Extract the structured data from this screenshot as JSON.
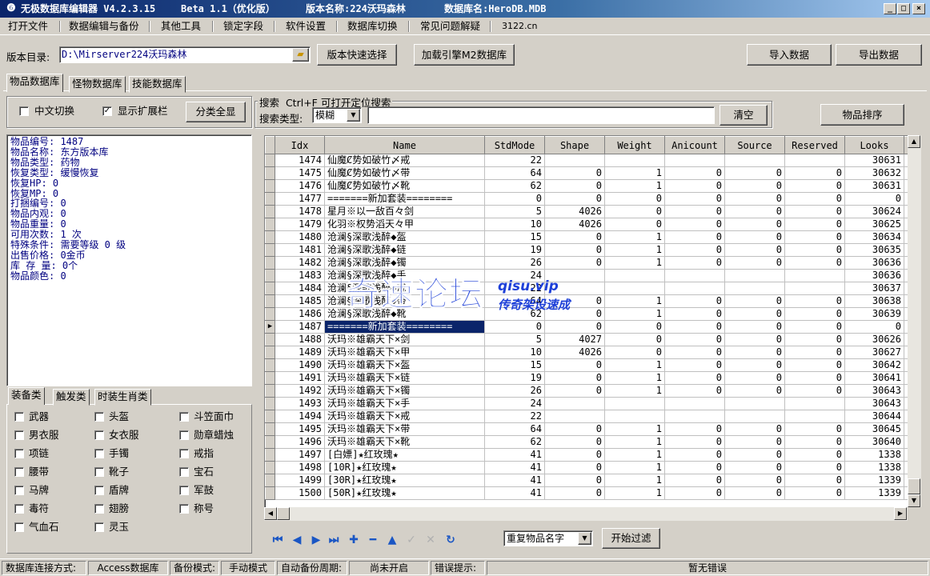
{
  "window": {
    "title_app": "无极数据库编辑器 V4.2.3.15",
    "title_beta": "Beta 1.1（优化版）",
    "title_version": "版本名称:224沃玛森林",
    "title_db": "数据库名:HeroDB.MDB",
    "btn_min": "_",
    "btn_max": "□",
    "btn_close": "×"
  },
  "menu": [
    "打开文件",
    "数据编辑与备份",
    "其他工具",
    "锁定字段",
    "软件设置",
    "数据库切换",
    "常见问题解疑",
    "3122.cn"
  ],
  "toolbar": {
    "dir_label": "版本目录:",
    "dir_value": "D:\\Mirserver224沃玛森林",
    "quick_select": "版本快速选择",
    "load_engine": "加载引擎M2数据库",
    "import": "导入数据",
    "export": "导出数据"
  },
  "tabs": [
    "物品数据库",
    "怪物数据库",
    "技能数据库"
  ],
  "left_panel": {
    "chinese_toggle": "中文切换",
    "chinese_checked": false,
    "show_ext": "显示扩展栏",
    "show_ext_checked": true,
    "show_all": "分类全显"
  },
  "search": {
    "group_title": "搜索  Ctrl+F 可打开定位搜索",
    "type_label": "搜索类型:",
    "type_value": "模糊",
    "query": "",
    "clear": "清空",
    "sort": "物品排序"
  },
  "item_info": [
    "物品编号: 1487",
    "物品名称: 东方版本库",
    "物品类型: 药物",
    "恢复类型: 缓慢恢复",
    "恢复HP: 0",
    "恢复MP: 0",
    "打捆编号: 0",
    "物品内观: 0",
    "物品重量: 0",
    "可用次数: 1 次",
    "特殊条件: 需要等级 0 级",
    "出售价格: 0金币",
    "库 存 量: 0个",
    "物品颜色: 0"
  ],
  "category_tabs": [
    "装备类",
    "触发类",
    "时装生肖类"
  ],
  "categories": [
    [
      "武器",
      "头盔",
      "斗笠面巾"
    ],
    [
      "男衣服",
      "女衣服",
      "勋章蜡烛"
    ],
    [
      "项链",
      "手镯",
      "戒指"
    ],
    [
      "腰带",
      "靴子",
      "宝石"
    ],
    [
      "马牌",
      "盾牌",
      "军鼓"
    ],
    [
      "毒符",
      "翅膀",
      "称号"
    ],
    [
      "气血石",
      "灵玉",
      ""
    ]
  ],
  "grid": {
    "columns": [
      "Idx",
      "Name",
      "StdMode",
      "Shape",
      "Weight",
      "Anicount",
      "Source",
      "Reserved",
      "Looks"
    ],
    "selected_idx": "1487",
    "rows": [
      [
        "1474",
        "仙魔Ȼ势如破竹〆戒",
        "22",
        "",
        "",
        "",
        "",
        "",
        "30631"
      ],
      [
        "1475",
        "仙魔Ȼ势如破竹〆带",
        "64",
        "0",
        "1",
        "0",
        "0",
        "0",
        "30632"
      ],
      [
        "1476",
        "仙魔Ȼ势如破竹〆靴",
        "62",
        "0",
        "1",
        "0",
        "0",
        "0",
        "30631"
      ],
      [
        "1477",
        "=======新加套装========",
        "0",
        "0",
        "0",
        "0",
        "0",
        "0",
        "0"
      ],
      [
        "1478",
        "星月※以一敌百々剑",
        "5",
        "4026",
        "0",
        "0",
        "0",
        "0",
        "30624"
      ],
      [
        "1479",
        "化羽※权势滔天々甲",
        "10",
        "4026",
        "0",
        "0",
        "0",
        "0",
        "30625"
      ],
      [
        "1480",
        "沧澜§深歌浅醉◆盔",
        "15",
        "0",
        "1",
        "0",
        "0",
        "0",
        "30634"
      ],
      [
        "1481",
        "沧澜§深歌浅醉◆链",
        "19",
        "0",
        "1",
        "0",
        "0",
        "0",
        "30635"
      ],
      [
        "1482",
        "沧澜§深歌浅醉◆镯",
        "26",
        "0",
        "1",
        "0",
        "0",
        "0",
        "30636"
      ],
      [
        "1483",
        "沧澜§深歌浅醉◆手",
        "24",
        "",
        "",
        "",
        "",
        "",
        "30636"
      ],
      [
        "1484",
        "沧澜§深歌浅醉◆戒",
        "22",
        "",
        "",
        "",
        "",
        "",
        "30637"
      ],
      [
        "1485",
        "沧澜§深歌浅醉◆带",
        "64",
        "0",
        "1",
        "0",
        "0",
        "0",
        "30638"
      ],
      [
        "1486",
        "沧澜§深歌浅醉◆靴",
        "62",
        "0",
        "1",
        "0",
        "0",
        "0",
        "30639"
      ],
      [
        "1487",
        "=======新加套装========",
        "0",
        "0",
        "0",
        "0",
        "0",
        "0",
        "0"
      ],
      [
        "1488",
        "沃玛※雄霸天下×剑",
        "5",
        "4027",
        "0",
        "0",
        "0",
        "0",
        "30626"
      ],
      [
        "1489",
        "沃玛※雄霸天下×甲",
        "10",
        "4026",
        "0",
        "0",
        "0",
        "0",
        "30627"
      ],
      [
        "1490",
        "沃玛※雄霸天下×盔",
        "15",
        "0",
        "1",
        "0",
        "0",
        "0",
        "30642"
      ],
      [
        "1491",
        "沃玛※雄霸天下×链",
        "19",
        "0",
        "1",
        "0",
        "0",
        "0",
        "30641"
      ],
      [
        "1492",
        "沃玛※雄霸天下×镯",
        "26",
        "0",
        "1",
        "0",
        "0",
        "0",
        "30643"
      ],
      [
        "1493",
        "沃玛※雄霸天下×手",
        "24",
        "",
        "",
        "",
        "",
        "",
        "30643"
      ],
      [
        "1494",
        "沃玛※雄霸天下×戒",
        "22",
        "",
        "",
        "",
        "",
        "",
        "30644"
      ],
      [
        "1495",
        "沃玛※雄霸天下×带",
        "64",
        "0",
        "1",
        "0",
        "0",
        "0",
        "30645"
      ],
      [
        "1496",
        "沃玛※雄霸天下×靴",
        "62",
        "0",
        "1",
        "0",
        "0",
        "0",
        "30640"
      ],
      [
        "1497",
        "[白嫖]★红玫瑰★",
        "41",
        "0",
        "1",
        "0",
        "0",
        "0",
        "1338"
      ],
      [
        "1498",
        "[10R]★红玫瑰★",
        "41",
        "0",
        "1",
        "0",
        "0",
        "0",
        "1338"
      ],
      [
        "1499",
        "[30R]★红玫瑰★",
        "41",
        "0",
        "1",
        "0",
        "0",
        "0",
        "1339"
      ],
      [
        "1500",
        "[50R]★红玫瑰★",
        "41",
        "0",
        "1",
        "0",
        "0",
        "0",
        "1339"
      ]
    ]
  },
  "navigator": {
    "icons": [
      "first-icon",
      "prior-icon",
      "next-icon",
      "last-icon",
      "insert-icon",
      "delete-icon",
      "edit-icon",
      "post-icon",
      "cancel-icon",
      "refresh-icon"
    ],
    "filter_value": "重复物品名字",
    "start_filter": "开始过滤"
  },
  "watermark": {
    "big": "奇速论坛",
    "url": "qisu.vip",
    "sub": "传奇架设速成"
  },
  "status": {
    "conn_label": "数据库连接方式:",
    "conn_value": "Access数据库",
    "backup_label": "备份模式:",
    "backup_value": "手动模式",
    "auto_label": "自动备份周期:",
    "auto_value": "尚未开启",
    "error_label": "错误提示:",
    "error_value": "暂无错误"
  },
  "colors": {
    "title_start": "#0a246a",
    "selection": "#0a246a",
    "info_text": "#000080",
    "nav_icons": "#1a56c4"
  }
}
